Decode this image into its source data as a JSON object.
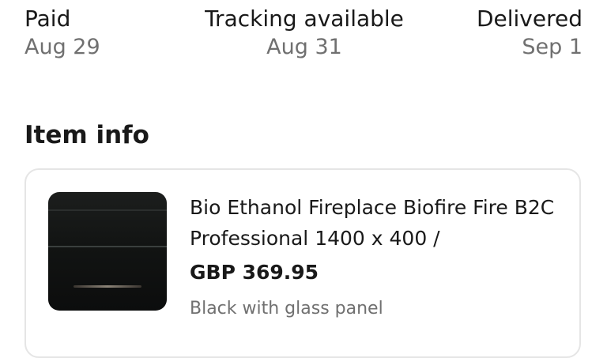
{
  "timeline": {
    "steps": [
      {
        "label": "Paid",
        "date": "Aug 29"
      },
      {
        "label": "Tracking available",
        "date": "Aug 31"
      },
      {
        "label": "Delivered",
        "date": "Sep 1"
      }
    ]
  },
  "item_info": {
    "title": "Item info",
    "item": {
      "name": "Bio Ethanol Fireplace Biofire Fire B2C Professional 1400 x 400 /",
      "price": "GBP 369.95",
      "variant": "Black with glass panel"
    }
  },
  "colors": {
    "text_primary": "#191919",
    "text_secondary": "#707070",
    "card_border": "#e5e5e5"
  }
}
